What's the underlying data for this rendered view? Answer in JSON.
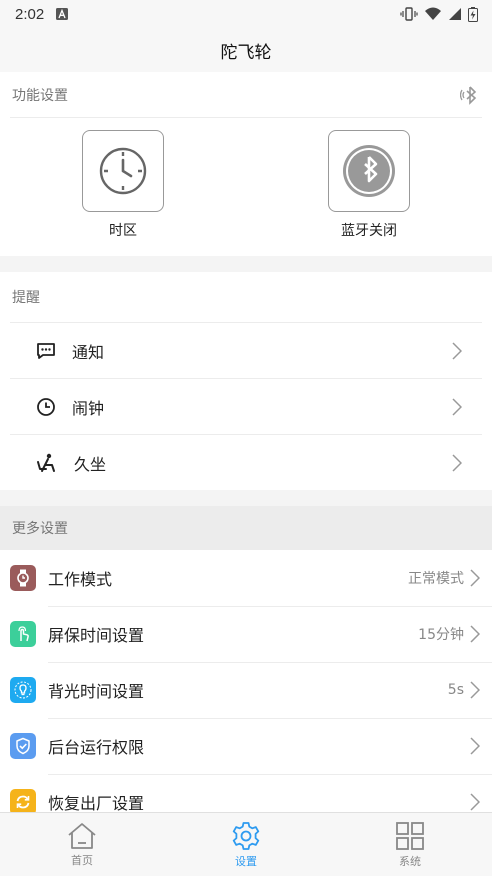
{
  "status_bar": {
    "time": "2:02"
  },
  "header": {
    "title": "陀飞轮"
  },
  "function_settings": {
    "title": "功能设置",
    "items": [
      {
        "label": "时区",
        "icon": "clock-icon"
      },
      {
        "label": "蓝牙关闭",
        "icon": "bluetooth-icon"
      }
    ]
  },
  "reminders": {
    "title": "提醒",
    "items": [
      {
        "label": "通知",
        "icon": "message-icon"
      },
      {
        "label": "闹钟",
        "icon": "clock-icon"
      },
      {
        "label": "久坐",
        "icon": "sitting-icon"
      }
    ]
  },
  "more_settings": {
    "title": "更多设置",
    "items": [
      {
        "label": "工作模式",
        "value": "正常模式",
        "icon": "watch-icon",
        "color": "#9a5b5b"
      },
      {
        "label": "屏保时间设置",
        "value": "15分钟",
        "icon": "touch-icon",
        "color": "#3ccf9a"
      },
      {
        "label": "背光时间设置",
        "value": "5s",
        "icon": "bulb-icon",
        "color": "#1eaaf0"
      },
      {
        "label": "后台运行权限",
        "value": "",
        "icon": "shield-icon",
        "color": "#5b9cf0"
      },
      {
        "label": "恢复出厂设置",
        "value": "",
        "icon": "refresh-icon",
        "color": "#f5b31a"
      }
    ]
  },
  "bottom_nav": {
    "items": [
      {
        "label": "首页",
        "icon": "home-icon",
        "active": false
      },
      {
        "label": "设置",
        "icon": "gear-icon",
        "active": true
      },
      {
        "label": "系统",
        "icon": "grid-icon",
        "active": false
      }
    ]
  },
  "colors": {
    "accent": "#2e9bf0"
  }
}
